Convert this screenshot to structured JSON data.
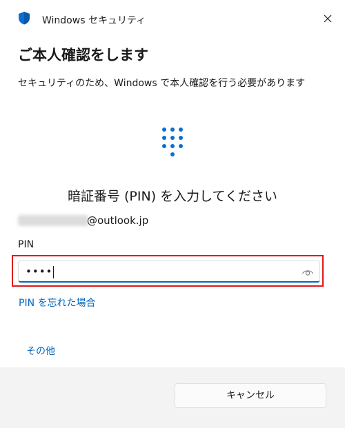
{
  "window": {
    "title": "Windows セキュリティ"
  },
  "dialog": {
    "heading": "ご本人確認をします",
    "description": "セキュリティのため、Windows で本人確認を行う必要があります",
    "prompt": "暗証番号 (PIN) を入力してください",
    "account_domain": "@outlook.jp",
    "pin_label": "PIN",
    "pin_value": "••••",
    "forgot_pin_link": "PIN を忘れた場合",
    "other_options_link": "その他",
    "cancel_button": "キャンセル"
  },
  "icons": {
    "app": "shield-icon",
    "close": "close-icon",
    "keypad": "keypad-icon",
    "reveal": "eye-icon"
  },
  "colors": {
    "accent": "#0067c0",
    "highlight_box": "#e01818",
    "footer_bg": "#f3f3f3"
  }
}
